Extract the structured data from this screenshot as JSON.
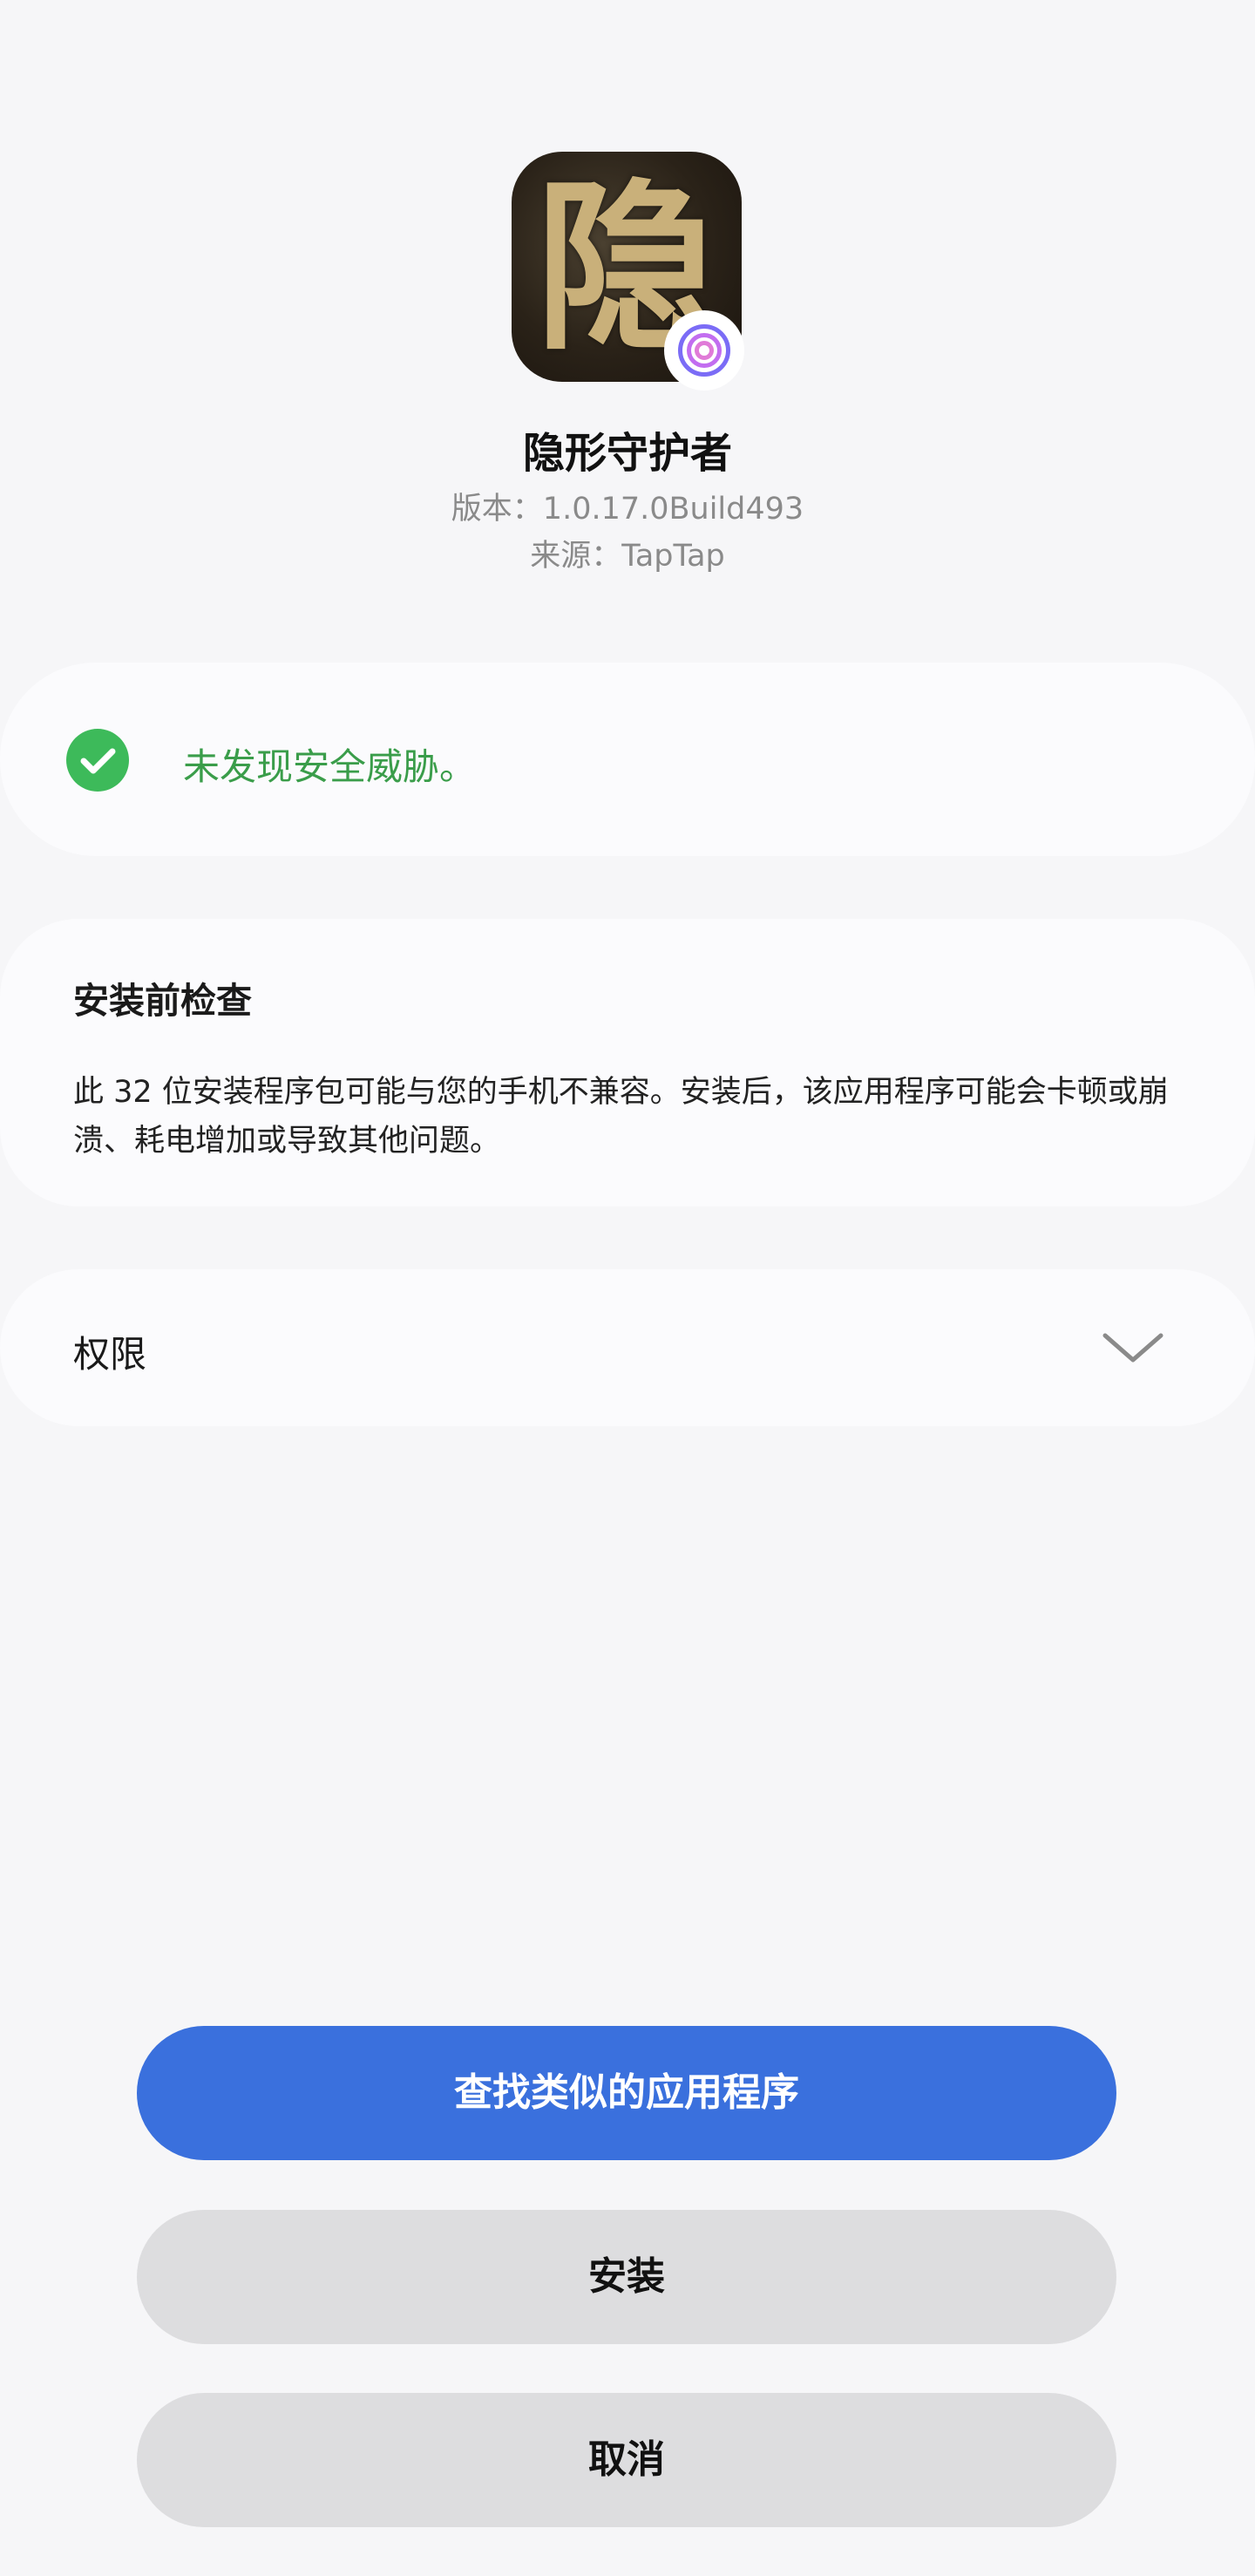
{
  "app": {
    "name": "隐形守护者",
    "icon_glyph": "隐",
    "version": "版本：1.0.17.0Build493",
    "source": "来源：TapTap"
  },
  "security": {
    "message": "未发现安全威胁。",
    "icon": "check-circle-icon",
    "color": "#3dba5a"
  },
  "precheck": {
    "title": "安装前检查",
    "body": "此 32 位安装程序包可能与您的手机不兼容。安装后，该应用程序可能会卡顿或崩溃、耗电增加或导致其他问题。"
  },
  "permissions": {
    "label": "权限",
    "icon": "chevron-down-icon"
  },
  "buttons": {
    "find_similar": "查找类似的应用程序",
    "install": "安装",
    "cancel": "取消"
  },
  "colors": {
    "primary": "#3a70dd",
    "secondary_button": "#dddddf",
    "background": "#f6f6f8",
    "success_text": "#3a9d4a"
  }
}
